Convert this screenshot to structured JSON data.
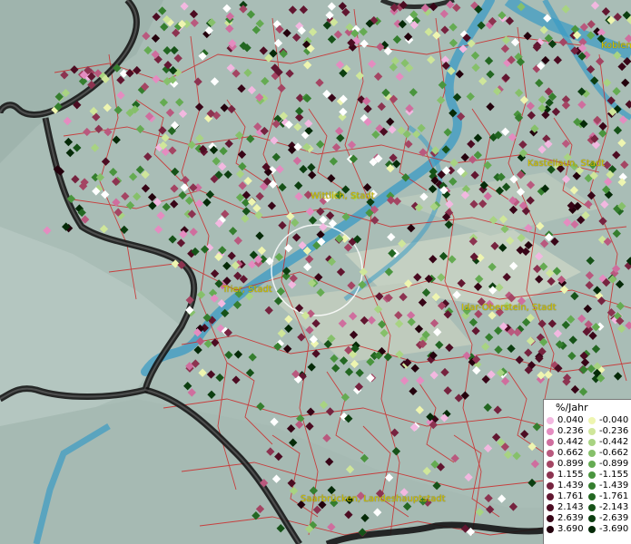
{
  "map": {
    "unit_label": "%/Jahr",
    "towns": [
      "Koblen",
      "Kastellaun, Stadt",
      "Wittlich, Stadt",
      "Trier, Stadt",
      "Idar-Oberstein, Stadt",
      "Saarbrücken, Landeshauptstadt"
    ]
  },
  "legend": {
    "title": "%/Jahr",
    "positive": [
      {
        "value": "0.040",
        "color": "#f2b8e0"
      },
      {
        "value": "0.236",
        "color": "#e48cc0"
      },
      {
        "value": "0.442",
        "color": "#cf6e9e"
      },
      {
        "value": "0.662",
        "color": "#b9597e"
      },
      {
        "value": "0.899",
        "color": "#a44563"
      },
      {
        "value": "1.155",
        "color": "#8c3350"
      },
      {
        "value": "1.439",
        "color": "#76233f"
      },
      {
        "value": "1.761",
        "color": "#611630"
      },
      {
        "value": "2.143",
        "color": "#4c0c22"
      },
      {
        "value": "2.639",
        "color": "#380517"
      },
      {
        "value": "3.690",
        "color": "#24020d"
      }
    ],
    "negative": [
      {
        "value": "-0.040",
        "color": "#eef5b0"
      },
      {
        "value": "-0.236",
        "color": "#cfe69a"
      },
      {
        "value": "-0.442",
        "color": "#a8d382"
      },
      {
        "value": "-0.662",
        "color": "#86c06a"
      },
      {
        "value": "-0.899",
        "color": "#65ab52"
      },
      {
        "value": "-1.155",
        "color": "#4a953e"
      },
      {
        "value": "-1.439",
        "color": "#357e2e"
      },
      {
        "value": "-1.761",
        "color": "#236722"
      },
      {
        "value": "-2.143",
        "color": "#165218"
      },
      {
        "value": "-2.639",
        "color": "#0c3e10"
      },
      {
        "value": "-3.690",
        "color": "#052a08"
      }
    ]
  },
  "colors": {
    "boundary": "#cc2a2a",
    "river": "#3b9bc4",
    "country_border": "#151515",
    "terrain": "#a9bdb6",
    "town_label": "#d4c400"
  }
}
